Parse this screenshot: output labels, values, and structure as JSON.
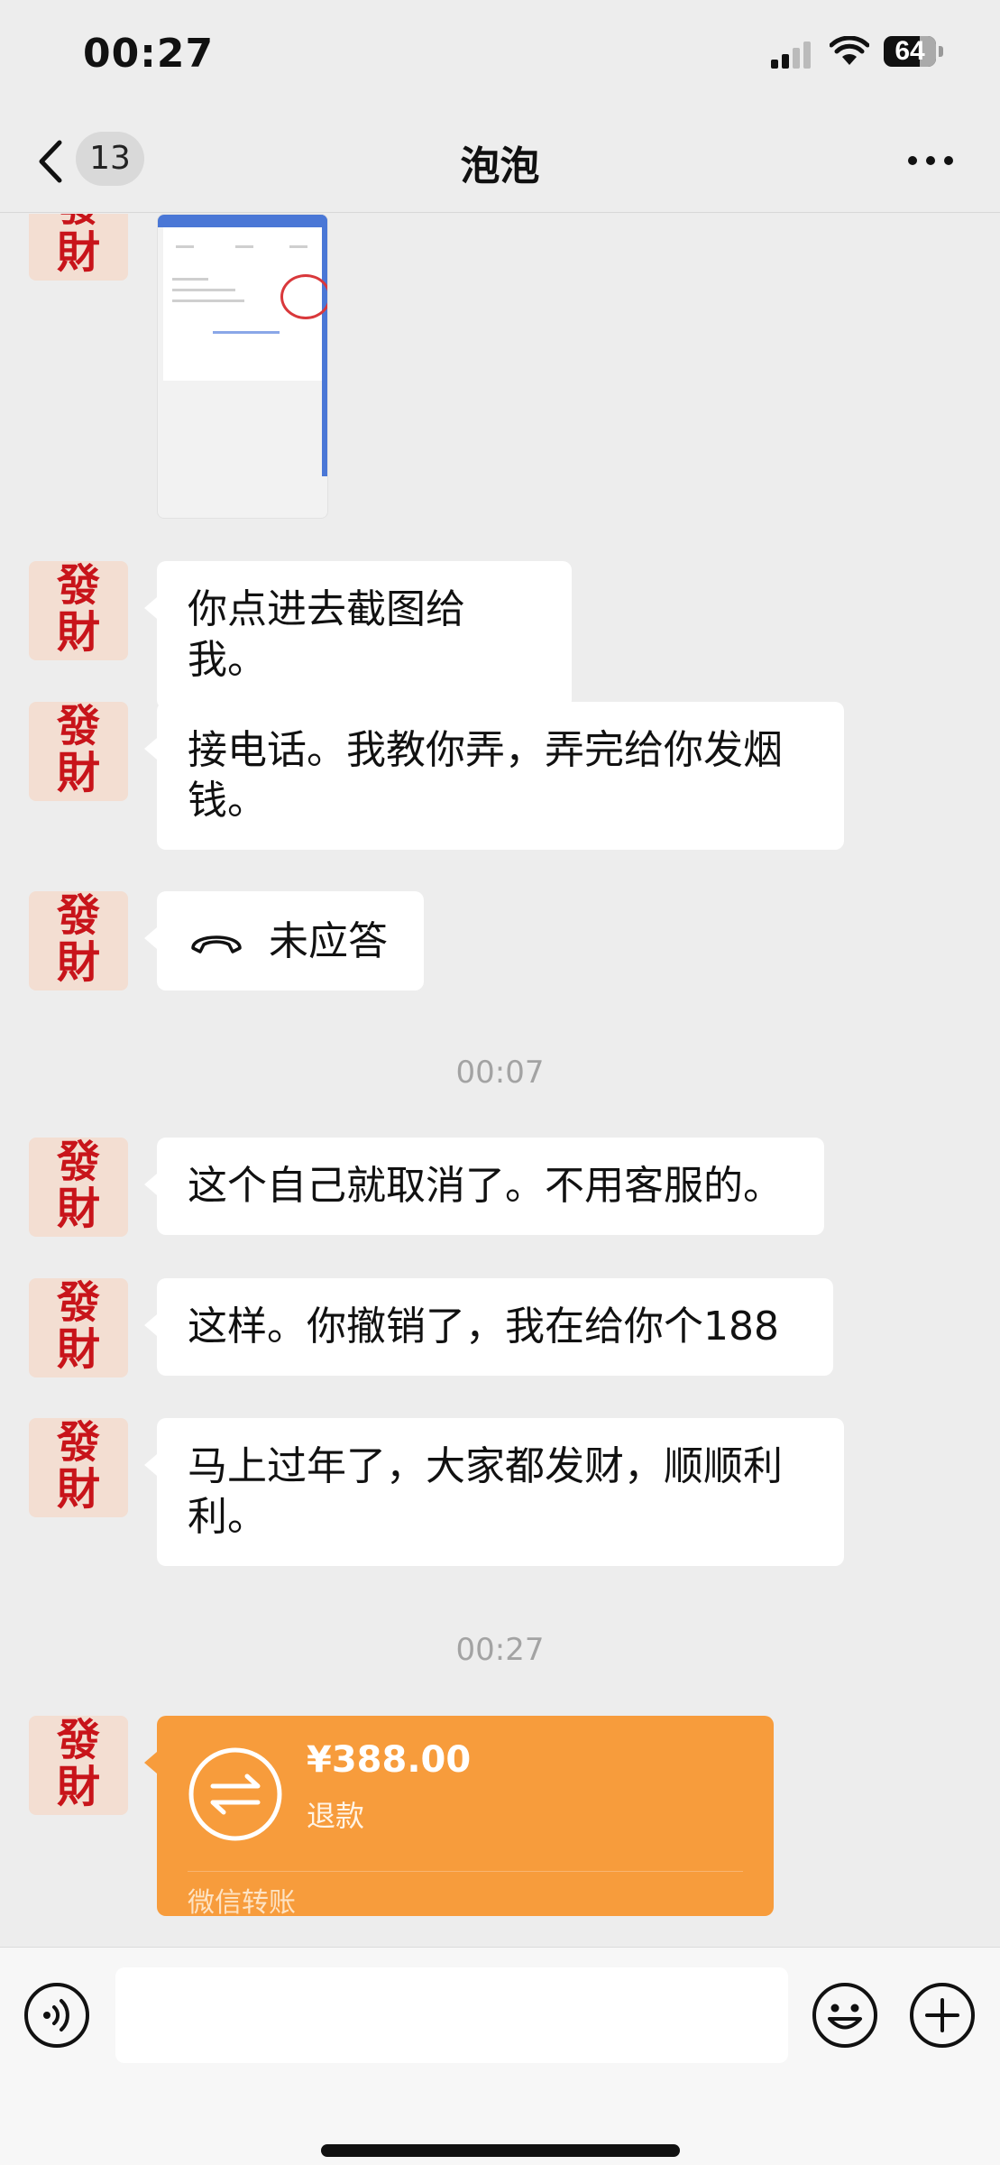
{
  "status_bar": {
    "time": "00:27",
    "battery": "64",
    "signal_icon": "cellular-signal-icon",
    "wifi_icon": "wifi-icon"
  },
  "nav": {
    "back_icon": "chevron-left-icon",
    "unread_count": "13",
    "title": "泡泡",
    "more_icon": "more-dots-icon"
  },
  "avatar": {
    "top_char": "發",
    "bottom_char": "財"
  },
  "messages": [
    {
      "type": "image",
      "description_icon": "screenshot-thumbnail"
    },
    {
      "type": "text",
      "text": "你点进去截图给我。"
    },
    {
      "type": "text",
      "text": "接电话。我教你弄，弄完给你发烟钱。"
    },
    {
      "type": "call",
      "text": "未应答",
      "icon": "phone-hangup-icon"
    },
    {
      "type": "time",
      "text": "00:07"
    },
    {
      "type": "text",
      "text": "这个自己就取消了。不用客服的。"
    },
    {
      "type": "text",
      "text": "这样。你撤销了，我在给你个188"
    },
    {
      "type": "text",
      "text": "马上过年了，大家都发财，顺顺利利。"
    },
    {
      "type": "time",
      "text": "00:27"
    },
    {
      "type": "transfer",
      "amount": "¥388.00",
      "status": "退款",
      "footer": "微信转账",
      "icon": "transfer-arrows-icon"
    }
  ],
  "input_bar": {
    "voice_icon": "voice-icon",
    "input_value": "",
    "emoji_icon": "emoji-icon",
    "plus_icon": "plus-icon"
  },
  "colors": {
    "background": "#ededed",
    "bubble": "#ffffff",
    "transfer": "#f79c3c",
    "avatar_text": "#c8141a"
  }
}
